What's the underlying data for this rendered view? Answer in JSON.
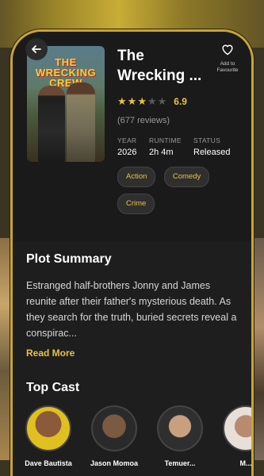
{
  "movie": {
    "title": "The Wrecking ...",
    "poster_title": "THE WRECKING CREW",
    "rating_value": "6.9",
    "stars": [
      true,
      true,
      true,
      false,
      false
    ],
    "reviews": "(677 reviews)",
    "year_label": "YEAR",
    "year": "2026",
    "runtime_label": "RUNTIME",
    "runtime": "2h 4m",
    "status_label": "STATUS",
    "status": "Released",
    "genres": [
      "Action",
      "Comedy",
      "Crime"
    ]
  },
  "favourite": {
    "label": "Add to Favourite",
    "icon": "heart-outline-icon"
  },
  "plot": {
    "heading": "Plot Summary",
    "text": "Estranged half-brothers Jonny and James reunite after their father's mysterious death. As they search for the truth, buried secrets reveal a conspirac...",
    "read_more": "Read More"
  },
  "cast": {
    "heading": "Top Cast",
    "members": [
      {
        "name": "Dave Bautista"
      },
      {
        "name": "Jason Momoa"
      },
      {
        "name": "Temuer..."
      },
      {
        "name": "M..."
      }
    ]
  },
  "colors": {
    "accent": "#e9c04a",
    "frame": "#c7a43c",
    "background": "#1a1a1a"
  }
}
